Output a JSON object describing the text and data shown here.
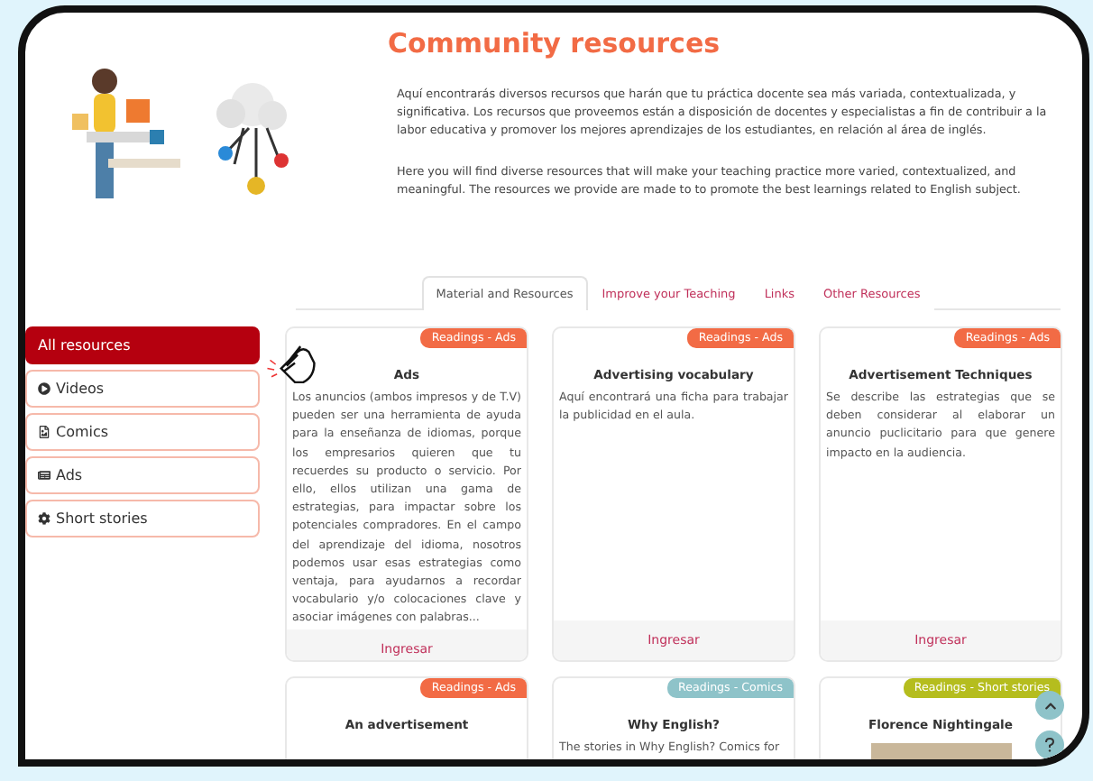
{
  "page": {
    "title": "Community resources",
    "intro_es": "Aquí encontrarás diversos recursos que harán que tu práctica docente sea más variada, contextualizada, y significativa. Los recursos que proveemos están a disposición de docentes y especialistas a fin de contribuir a la labor educativa y promover los mejores aprendizajes de los estudiantes, en relación al área de inglés.",
    "intro_en": "Here you will find diverse resources that will make your teaching practice more varied, contextualized, and meaningful. The resources we provide are made to to promote the best learnings related to English subject."
  },
  "tabs": [
    {
      "label": "Material and Resources",
      "selected": true
    },
    {
      "label": "Improve your Teaching",
      "selected": false
    },
    {
      "label": "Links",
      "selected": false
    },
    {
      "label": "Other Resources",
      "selected": false
    }
  ],
  "sidebar": {
    "items": [
      {
        "label": "All resources",
        "kind": "all",
        "selected": true
      },
      {
        "label": "Videos",
        "kind": "video",
        "selected": false
      },
      {
        "label": "Comics",
        "kind": "comic",
        "selected": false
      },
      {
        "label": "Ads",
        "kind": "ad",
        "selected": false
      },
      {
        "label": "Short stories",
        "kind": "story",
        "selected": false
      }
    ]
  },
  "cards": [
    {
      "tag": "Readings - Ads",
      "color": "#f26b45",
      "title": "Ads",
      "description": "Los anuncios (ambos impresos y de T.V) pueden ser una herramienta de ayuda para la enseñanza de idiomas, porque los empresarios quieren que tu recuerdes su producto o servicio. Por ello, ellos utilizan una gama de estrategias, para impactar sobre los potenciales compradores. En el campo del aprendizaje del idioma, nosotros podemos usar esas estrategias como ventaja, para ayudarnos a recordar vocabulario y/o colocaciones clave y asociar imágenes con palabras...",
      "has_image": false,
      "link": "Ingresar"
    },
    {
      "tag": "Readings - Ads",
      "color": "#f26b45",
      "title": "Advertising vocabulary",
      "description": "Aquí encontrará una ficha para trabajar la publicidad en el aula.",
      "has_image": false,
      "link": "Ingresar"
    },
    {
      "tag": "Readings - Ads",
      "color": "#f26b45",
      "title": "Advertisement Techniques",
      "description": "Se describe las estrategias que se deben considerar al elaborar un anuncio puclicitario para que genere impacto en la audiencia.",
      "has_image": false,
      "link": "Ingresar"
    },
    {
      "tag": "Readings - Ads",
      "color": "#f26b45",
      "title": "An advertisement",
      "has_image": false
    },
    {
      "tag": "Readings - Comics",
      "color": "#8ec3c9",
      "title": "Why English?",
      "description": "The stories in Why English? Comics for",
      "has_image": false
    },
    {
      "tag": "Readings - Short stories",
      "color": "#b5bd1e",
      "title": "Florence Nightingale",
      "has_image": true
    }
  ]
}
